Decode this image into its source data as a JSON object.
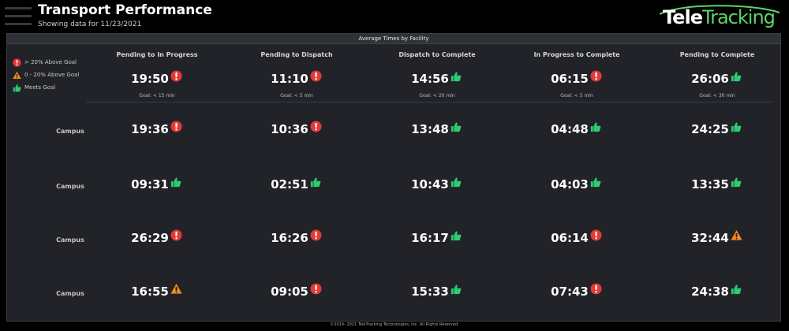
{
  "header": {
    "title": "Transport Performance",
    "subtitle": "Showing data for  11/23/2021",
    "logo_tele": "Tele",
    "logo_tracking": "Tracking"
  },
  "panel": {
    "title": "Average Times by Facility"
  },
  "legend": [
    {
      "status": "red",
      "icon": "exclamation-icon",
      "label": "> 20% Above Goal"
    },
    {
      "status": "orange",
      "icon": "warning-triangle-icon",
      "label": "0 - 20% Above Goal"
    },
    {
      "status": "green",
      "icon": "thumbs-up-icon",
      "label": "Meets Goal"
    }
  ],
  "colors": {
    "red": "#e53935",
    "orange": "#f28c1b",
    "green": "#2ecc71",
    "background": "#000000",
    "panel": "#212329",
    "logo_green": "#5fd36a"
  },
  "columns": [
    {
      "name": "Pending to In Progress",
      "avg": "19:50",
      "status": "red",
      "goal": "Goal: < 15 min"
    },
    {
      "name": "Pending to Dispatch",
      "avg": "11:10",
      "status": "red",
      "goal": "Goal: < 5 min"
    },
    {
      "name": "Dispatch to Complete",
      "avg": "14:56",
      "status": "green",
      "goal": "Goal: < 20 min"
    },
    {
      "name": "In Progress to Complete",
      "avg": "06:15",
      "status": "red",
      "goal": "Goal: < 5 min"
    },
    {
      "name": "Pending to Complete",
      "avg": "26:06",
      "status": "green",
      "goal": "Goal: < 30 min"
    }
  ],
  "rows": [
    {
      "label": "Campus",
      "cells": [
        {
          "time": "19:36",
          "status": "red"
        },
        {
          "time": "10:36",
          "status": "red"
        },
        {
          "time": "13:48",
          "status": "green"
        },
        {
          "time": "04:48",
          "status": "green"
        },
        {
          "time": "24:25",
          "status": "green"
        }
      ]
    },
    {
      "label": "Campus",
      "cells": [
        {
          "time": "09:31",
          "status": "green"
        },
        {
          "time": "02:51",
          "status": "green"
        },
        {
          "time": "10:43",
          "status": "green"
        },
        {
          "time": "04:03",
          "status": "green"
        },
        {
          "time": "13:35",
          "status": "green"
        }
      ]
    },
    {
      "label": "Campus",
      "cells": [
        {
          "time": "26:29",
          "status": "red"
        },
        {
          "time": "16:26",
          "status": "red"
        },
        {
          "time": "16:17",
          "status": "green"
        },
        {
          "time": "06:14",
          "status": "red"
        },
        {
          "time": "32:44",
          "status": "orange"
        }
      ]
    },
    {
      "label": "Campus",
      "cells": [
        {
          "time": "16:55",
          "status": "orange"
        },
        {
          "time": "09:05",
          "status": "red"
        },
        {
          "time": "15:33",
          "status": "green"
        },
        {
          "time": "07:43",
          "status": "red"
        },
        {
          "time": "24:38",
          "status": "green"
        }
      ]
    }
  ],
  "footer": {
    "text": "©2019- 2021 TeleTracking Technologies, Inc. All Rights Reserved."
  }
}
